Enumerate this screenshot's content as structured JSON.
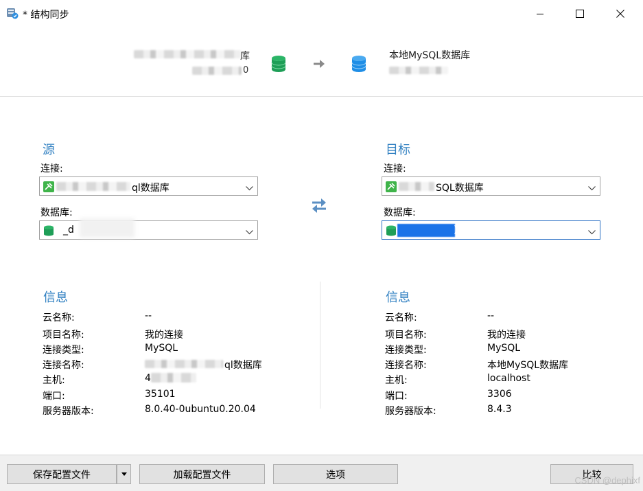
{
  "window": {
    "title": "* 结构同步"
  },
  "header": {
    "source_name_tail": "库",
    "source_db_tail": "0",
    "target_name": "本地MySQL数据库"
  },
  "source": {
    "section_title": "源",
    "connection_label": "连接:",
    "connection_value": "ql数据库",
    "database_label": "数据库:",
    "database_value": "_d"
  },
  "target": {
    "section_title": "目标",
    "connection_label": "连接:",
    "connection_value": "SQL数据库",
    "database_label": "数据库:",
    "database_value": ")"
  },
  "source_info": {
    "title": "信息",
    "rows": [
      {
        "key": "云名称:",
        "value": "--"
      },
      {
        "key": "项目名称:",
        "value": "我的连接"
      },
      {
        "key": "连接类型:",
        "value": "MySQL"
      },
      {
        "key": "连接名称:",
        "value": "ql数据库"
      },
      {
        "key": "主机:",
        "value": "4"
      },
      {
        "key": "端口:",
        "value": "35101"
      },
      {
        "key": "服务器版本:",
        "value": "8.0.40-0ubuntu0.20.04"
      }
    ]
  },
  "target_info": {
    "title": "信息",
    "rows": [
      {
        "key": "云名称:",
        "value": "--"
      },
      {
        "key": "项目名称:",
        "value": "我的连接"
      },
      {
        "key": "连接类型:",
        "value": "MySQL"
      },
      {
        "key": "连接名称:",
        "value": "本地MySQL数据库"
      },
      {
        "key": "主机:",
        "value": "localhost"
      },
      {
        "key": "端口:",
        "value": "3306"
      },
      {
        "key": "服务器版本:",
        "value": "8.4.3"
      }
    ]
  },
  "footer": {
    "save_profile": "保存配置文件",
    "load_profile": "加载配置文件",
    "options": "选项",
    "compare": "比较"
  },
  "watermark": "CSDN @dephixf",
  "colors": {
    "section_title": "#2f7fc1",
    "db_green": "#1e9e57",
    "db_blue": "#1f8ee6",
    "focus_border": "#2a6fc4"
  },
  "icons": {
    "app": "structure-sync-app-icon",
    "source_db": "green-database-icon",
    "target_db": "blue-database-icon",
    "connection": "mysql-connection-icon",
    "swap": "swap-arrows-icon"
  }
}
